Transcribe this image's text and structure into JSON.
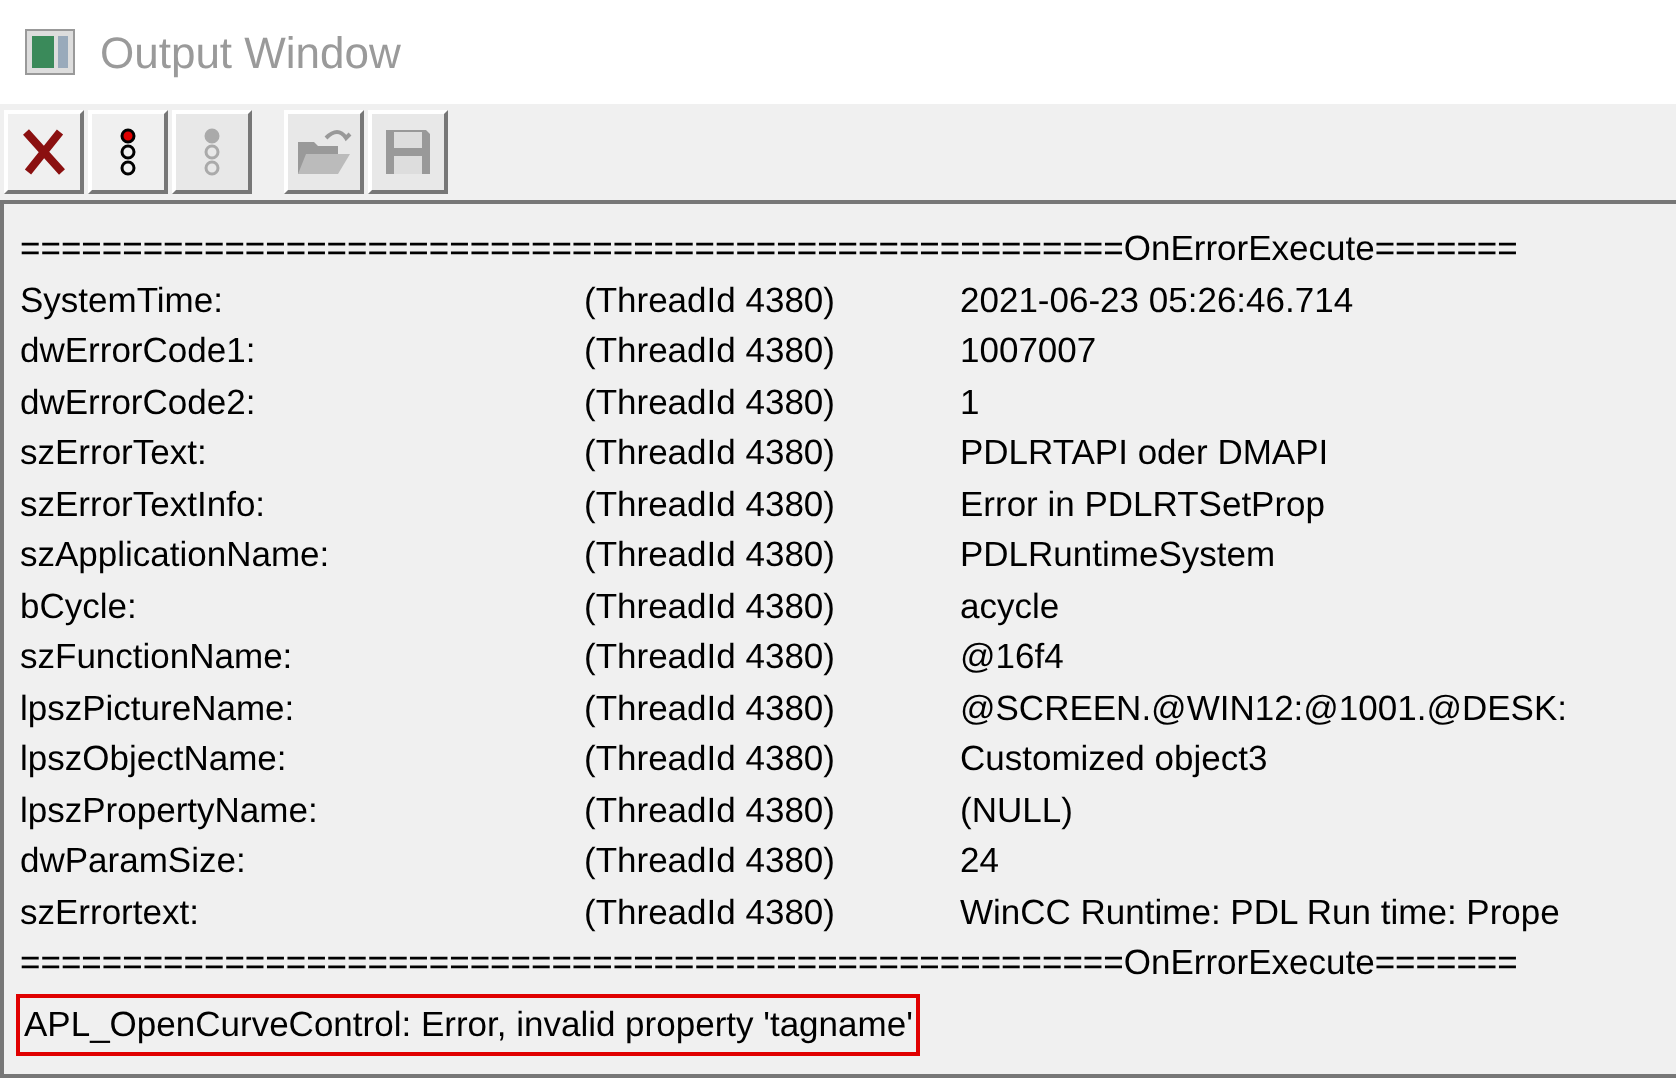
{
  "window": {
    "title": "Output Window"
  },
  "toolbar": [
    {
      "kind": "delete",
      "disabled": false
    },
    {
      "kind": "trace",
      "disabled": false
    },
    {
      "kind": "trace",
      "disabled": true
    },
    {
      "kind": "open",
      "disabled": true
    },
    {
      "kind": "save",
      "disabled": true
    }
  ],
  "output": {
    "lines": [
      {
        "kind": "separator",
        "text": "======================================================OnErrorExecute======="
      },
      {
        "kind": "entry",
        "name": "SystemTime:",
        "thread": "(ThreadId 4380)",
        "value": "2021-06-23 05:26:46.714"
      },
      {
        "kind": "entry",
        "name": "dwErrorCode1:",
        "thread": "(ThreadId 4380)",
        "value": "1007007"
      },
      {
        "kind": "entry",
        "name": "dwErrorCode2:",
        "thread": "(ThreadId 4380)",
        "value": "1"
      },
      {
        "kind": "entry",
        "name": "szErrorText:",
        "thread": "(ThreadId 4380)",
        "value": "PDLRTAPI oder DMAPI"
      },
      {
        "kind": "entry",
        "name": "szErrorTextInfo:",
        "thread": "(ThreadId 4380)",
        "value": "Error in PDLRTSetProp"
      },
      {
        "kind": "entry",
        "name": "szApplicationName:",
        "thread": "(ThreadId 4380)",
        "value": "PDLRuntimeSystem"
      },
      {
        "kind": "entry",
        "name": "bCycle:",
        "thread": "(ThreadId 4380)",
        "value": "acycle"
      },
      {
        "kind": "entry",
        "name": "szFunctionName:",
        "thread": "(ThreadId 4380)",
        "value": "@16f4"
      },
      {
        "kind": "entry",
        "name": "lpszPictureName:",
        "thread": "(ThreadId 4380)",
        "value": "@SCREEN.@WIN12:@1001.@DESK:"
      },
      {
        "kind": "entry",
        "name": "lpszObjectName:",
        "thread": "(ThreadId 4380)",
        "value": "Customized object3"
      },
      {
        "kind": "entry",
        "name": "lpszPropertyName:",
        "thread": "(ThreadId 4380)",
        "value": "(NULL)"
      },
      {
        "kind": "entry",
        "name": "dwParamSize:",
        "thread": "(ThreadId 4380)",
        "value": "24"
      },
      {
        "kind": "entry",
        "name": "szErrortext:",
        "thread": "(ThreadId 4380)",
        "value": "WinCC Runtime: PDL Run time: Prope"
      },
      {
        "kind": "separator",
        "text": "======================================================OnErrorExecute======="
      },
      {
        "kind": "highlight",
        "text": "APL_OpenCurveControl: Error, invalid property 'tagname'"
      }
    ]
  }
}
